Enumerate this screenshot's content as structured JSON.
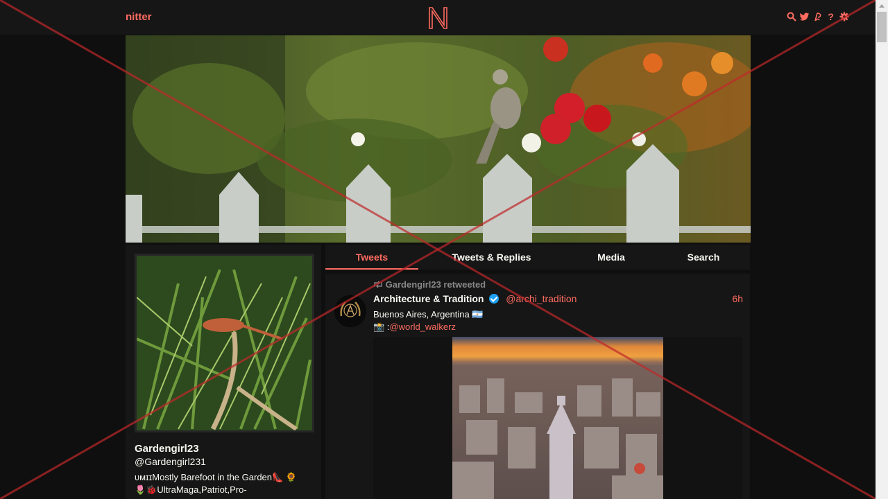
{
  "nav": {
    "brand": "nitter",
    "icons": [
      "search-icon",
      "twitter-bird-icon",
      "rss-icon",
      "help-icon",
      "gear-icon"
    ]
  },
  "profile": {
    "fullname": "Gardengirl23",
    "username": "@Gardengirl231",
    "bio_line1": "ᴜᴍɪɪMostly Barefoot in the Garden👠 🌻",
    "bio_line2": "🌷🐞UltraMaga,Patriot,Pro-"
  },
  "tabs": [
    {
      "label": "Tweets",
      "active": true
    },
    {
      "label": "Tweets & Replies",
      "active": false
    },
    {
      "label": "Media",
      "active": false
    },
    {
      "label": "Search",
      "active": false
    }
  ],
  "tweet": {
    "retweet_header": "Gardengirl23 retweeted",
    "fullname": "Architecture & Tradition",
    "username": "@archi_tradition",
    "date": "6h",
    "text_line1": "Buenos Aires, Argentina 🇦🇷",
    "camera": "📸 :",
    "mention": "@world_walkerz"
  },
  "colors": {
    "accent": "#ff6c60",
    "background": "#0f0f0f",
    "panel": "#161616",
    "overlay_cross": "#c0282a"
  }
}
